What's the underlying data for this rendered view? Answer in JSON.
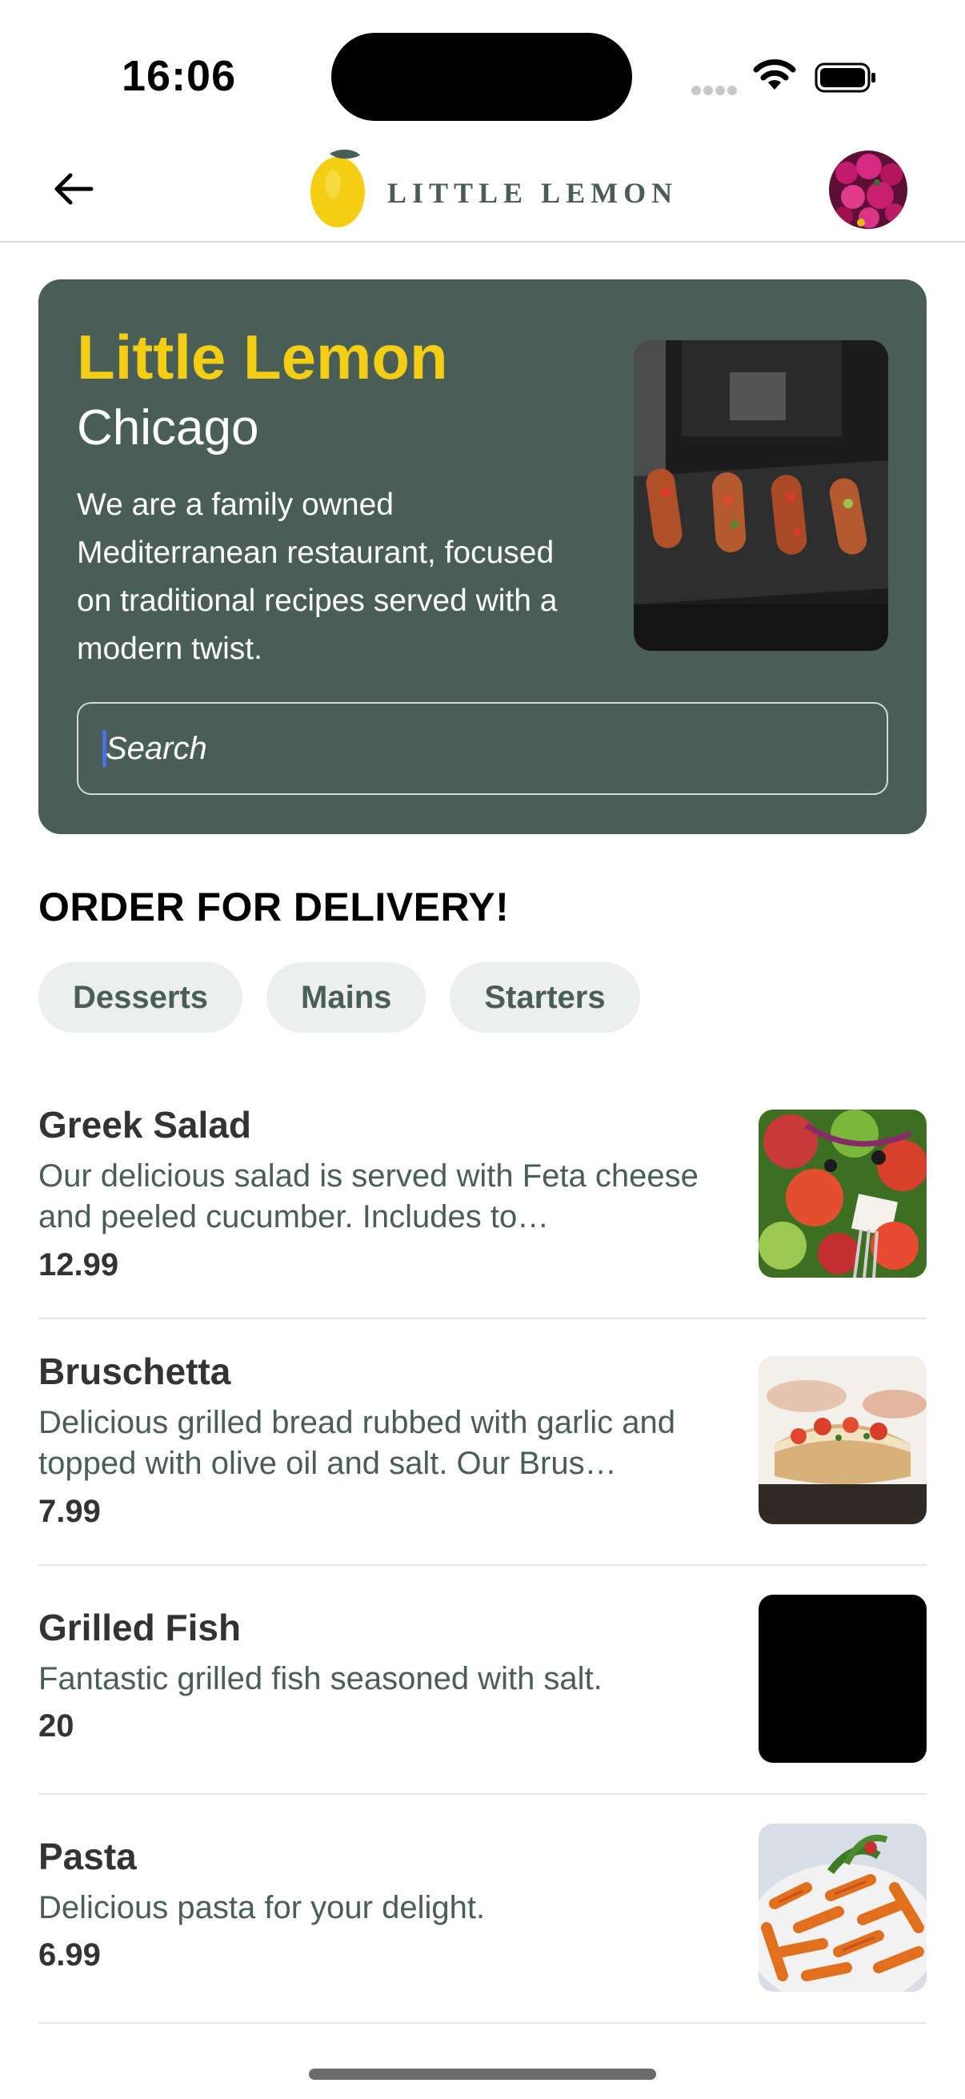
{
  "status_bar": {
    "time": "16:06",
    "icons": [
      "cellular-icon",
      "wifi-icon",
      "battery-icon"
    ]
  },
  "nav": {
    "back_icon": "arrow-left-icon",
    "logo_text": "LITTLE LEMON",
    "avatar": "profile-avatar"
  },
  "hero": {
    "title": "Little Lemon",
    "subtitle": "Chicago",
    "description": "We are a family owned Mediterranean restaurant, focused on traditional recipes served with a modern twist.",
    "search_placeholder": "Search",
    "colors": {
      "background": "#495e57",
      "title": "#f4ce14"
    }
  },
  "delivery": {
    "heading": "ORDER FOR DELIVERY!",
    "categories": [
      "Desserts",
      "Mains",
      "Starters"
    ]
  },
  "menu": [
    {
      "name": "Greek Salad",
      "description": "Our delicious salad is served with Feta cheese and peeled cucumber. Includes to…",
      "price": "12.99"
    },
    {
      "name": "Bruschetta",
      "description": "Delicious grilled bread rubbed with garlic and topped with olive oil and salt. Our Brus…",
      "price": "7.99"
    },
    {
      "name": "Grilled Fish",
      "description": "Fantastic grilled fish seasoned with salt.",
      "price": "20"
    },
    {
      "name": "Pasta",
      "description": "Delicious pasta for your delight.",
      "price": "6.99"
    }
  ]
}
